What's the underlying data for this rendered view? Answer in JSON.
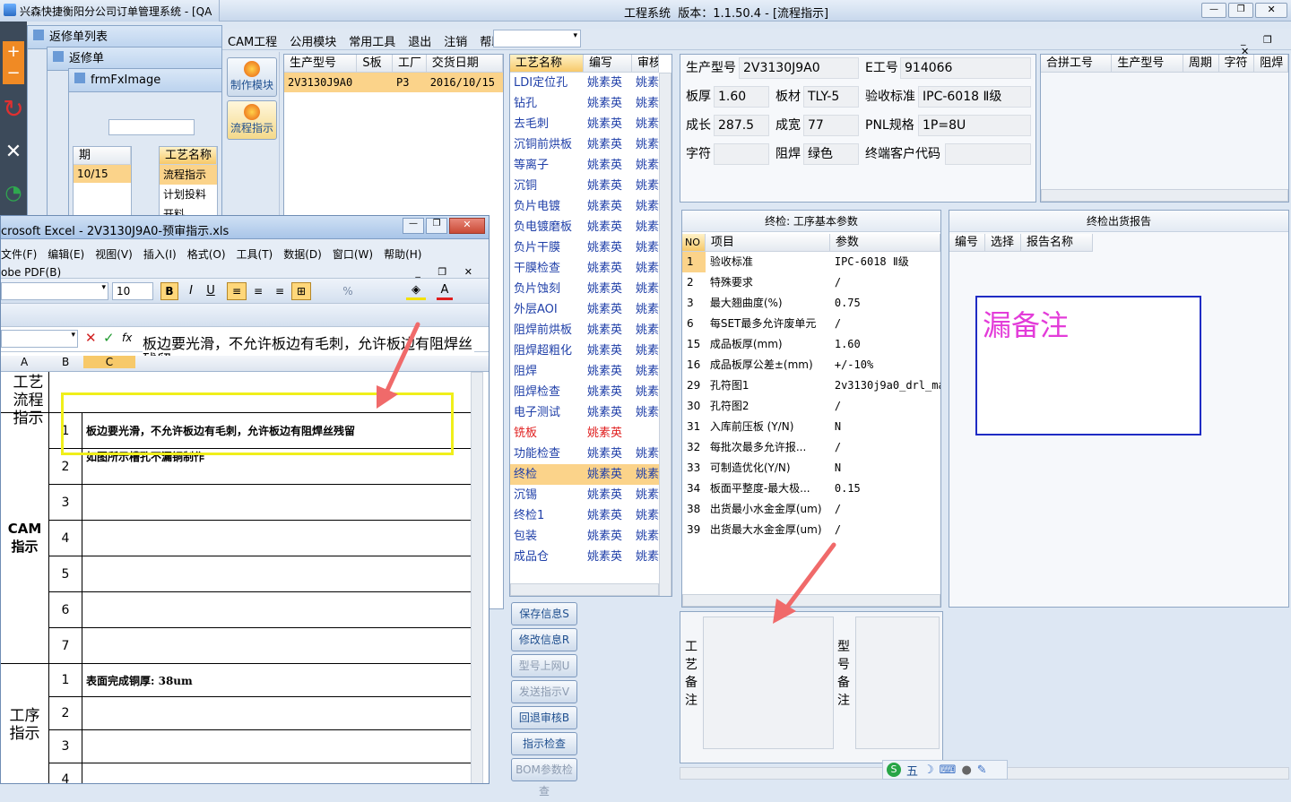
{
  "main_title": "兴森快捷衡阳分公司订单管理系统 - [QA",
  "sys_title": "工程系统  版本：1.1.50.4 - [流程指示]",
  "menu": [
    "CAM工程",
    "公用模块",
    "常用工具",
    "退出",
    "注销",
    "帮助"
  ],
  "left_buttons": [
    "制作模块",
    "流程指示"
  ],
  "order_grid": {
    "headers": [
      "生产型号",
      "S板",
      "工厂",
      "交货日期"
    ],
    "rows": [
      [
        "2V3130J9A0",
        "",
        "P3",
        "2016/10/15"
      ]
    ]
  },
  "process_grid": {
    "headers": [
      "工艺名称",
      "编写",
      "审核"
    ],
    "rows": [
      [
        "LDI定位孔",
        "姚素英",
        "姚素"
      ],
      [
        "钻孔",
        "姚素英",
        "姚素"
      ],
      [
        "去毛刺",
        "姚素英",
        "姚素"
      ],
      [
        "沉铜前烘板",
        "姚素英",
        "姚素"
      ],
      [
        "等离子",
        "姚素英",
        "姚素"
      ],
      [
        "沉铜",
        "姚素英",
        "姚素"
      ],
      [
        "负片电镀",
        "姚素英",
        "姚素"
      ],
      [
        "负电镀磨板",
        "姚素英",
        "姚素"
      ],
      [
        "负片干膜",
        "姚素英",
        "姚素"
      ],
      [
        "干膜检查",
        "姚素英",
        "姚素"
      ],
      [
        "负片蚀刻",
        "姚素英",
        "姚素"
      ],
      [
        "外层AOI",
        "姚素英",
        "姚素"
      ],
      [
        "阻焊前烘板",
        "姚素英",
        "姚素"
      ],
      [
        "阻焊超粗化",
        "姚素英",
        "姚素"
      ],
      [
        "阻焊",
        "姚素英",
        "姚素"
      ],
      [
        "阻焊检查",
        "姚素英",
        "姚素"
      ],
      [
        "电子测试",
        "姚素英",
        "姚素"
      ],
      [
        "铣板",
        "姚素英",
        ""
      ],
      [
        "功能检查",
        "姚素英",
        "姚素"
      ],
      [
        "终检",
        "姚素英",
        "姚素"
      ],
      [
        "沉锡",
        "姚素英",
        "姚素"
      ],
      [
        "终检1",
        "姚素英",
        "姚素"
      ],
      [
        "包装",
        "姚素英",
        "姚素"
      ],
      [
        "成品仓",
        "姚素英",
        "姚素"
      ]
    ]
  },
  "action_buttons": [
    "保存信息S",
    "修改信息R",
    "型号上网U",
    "发送指示V",
    "回退审核B",
    "指示检查",
    "BOM参数检查"
  ],
  "info": {
    "prod_model_label": "生产型号",
    "prod_model": "2V3130J9A0",
    "e_label": "E工号",
    "e_value": "914066",
    "thickness_label": "板厚",
    "thickness": "1.60",
    "material_label": "板材",
    "material": "TLY-5",
    "std_label": "验收标准",
    "std": "IPC-6018 Ⅱ级",
    "len_label": "成长",
    "len": "287.5",
    "wid_label": "成宽",
    "wid": "77",
    "pnl_label": "PNL规格",
    "pnl": "1P=8U",
    "char_label": "字符",
    "char": "",
    "mask_label": "阻焊",
    "mask": "绿色",
    "client_label": "终端客户代码",
    "client": ""
  },
  "merge_grid_headers": [
    "合拼工号",
    "生产型号",
    "周期",
    "字符",
    "阻焊"
  ],
  "params": {
    "title": "终检: 工序基本参数",
    "headers": [
      "NO",
      "项目",
      "参数"
    ],
    "rows": [
      [
        "1",
        "验收标准",
        "IPC-6018 Ⅱ级"
      ],
      [
        "2",
        "特殊要求",
        "/"
      ],
      [
        "3",
        "最大翘曲度(%)",
        "0.75"
      ],
      [
        "6",
        "每SET最多允许废单元",
        "/"
      ],
      [
        "15",
        "成品板厚(mm)",
        "1.60"
      ],
      [
        "16",
        "成品板厚公差±(mm)",
        "+/-10%"
      ],
      [
        "29",
        "孔符图1",
        "2v3130j9a0_drl_ma"
      ],
      [
        "30",
        "孔符图2",
        "/"
      ],
      [
        "31",
        "入库前压板 (Y/N)",
        "N"
      ],
      [
        "32",
        "每批次最多允许报...",
        "/"
      ],
      [
        "33",
        "可制造优化(Y/N)",
        "N"
      ],
      [
        "34",
        "板面平整度-最大极...",
        "0.15"
      ],
      [
        "38",
        "出货最小水金金厚(um)",
        "/"
      ],
      [
        "39",
        "出货最大水金金厚(um)",
        "/"
      ]
    ]
  },
  "report": {
    "title": "终检出货报告",
    "headers": [
      "编号",
      "选择",
      "报告名称"
    ],
    "note": "漏备注"
  },
  "remarks": {
    "process_label": "工艺备注",
    "model_label": "型号备注"
  },
  "win_repair_list": "返修单列表",
  "win_repair": "返修单",
  "win_fximage": "frmFxImage",
  "mini_grid": {
    "col1": "期",
    "val1": "10/15",
    "col2": "工艺名称",
    "items": [
      "流程指示",
      "计划投料",
      "开料"
    ]
  },
  "excel": {
    "title": "crosoft Excel - 2V3130J9A0-预审指示.xls",
    "menu": [
      "文件(F)",
      "编辑(E)",
      "视图(V)",
      "插入(I)",
      "格式(O)",
      "工具(T)",
      "数据(D)",
      "窗口(W)",
      "帮助(H)"
    ],
    "menu2": "obe PDF(B)",
    "font_size": "10",
    "formula": "板边要光滑，不允许板边有毛刺，允许板边有阻焊丝残留",
    "cols": [
      "A",
      "B",
      "C"
    ],
    "sec1": "工艺流程指示",
    "sec2": "CAM指示",
    "sec3": "工序指示",
    "cam_rows": [
      {
        "n": "1",
        "t": "板边要光滑，不允许板边有毛刺，允许板边有阻焊丝残留"
      },
      {
        "n": "2",
        "t": "如图所示槽孔不漏铜制作"
      },
      {
        "n": "3",
        "t": ""
      },
      {
        "n": "4",
        "t": ""
      },
      {
        "n": "5",
        "t": ""
      },
      {
        "n": "6",
        "t": ""
      },
      {
        "n": "7",
        "t": ""
      }
    ],
    "proc_rows": [
      {
        "n": "1",
        "t": "表面完成铜厚: 38um"
      },
      {
        "n": "2",
        "t": ""
      },
      {
        "n": "3",
        "t": ""
      },
      {
        "n": "4",
        "t": ""
      }
    ]
  },
  "tray": "五"
}
